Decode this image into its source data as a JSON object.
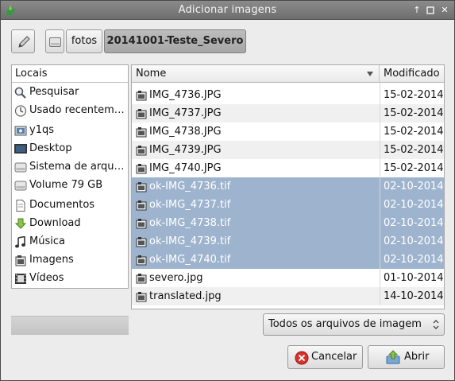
{
  "window": {
    "title": "Adicionar imagens"
  },
  "pathbar": {
    "segments": [
      "fotos",
      "20141001-Teste_Severo"
    ]
  },
  "places": {
    "header": "Locais",
    "items": [
      {
        "label": "Pesquisar",
        "icon": "search-icon"
      },
      {
        "label": "Usado recentem…",
        "icon": "clock-icon"
      },
      {
        "label": "y1qs",
        "icon": "home-folder-icon"
      },
      {
        "label": "Desktop",
        "icon": "desktop-icon"
      },
      {
        "label": "Sistema de arqu…",
        "icon": "harddisk-icon"
      },
      {
        "label": "Volume 79 GB",
        "icon": "harddisk-icon"
      },
      {
        "label": "Documentos",
        "icon": "document-icon"
      },
      {
        "label": "Download",
        "icon": "download-icon"
      },
      {
        "label": "Música",
        "icon": "music-icon"
      },
      {
        "label": "Imagens",
        "icon": "image-icon"
      },
      {
        "label": "Vídeos",
        "icon": "video-icon"
      }
    ]
  },
  "files": {
    "columns": {
      "name": "Nome",
      "modified": "Modificado"
    },
    "rows": [
      {
        "name": "IMG_4736.JPG",
        "date": "15-02-2014",
        "selected": false
      },
      {
        "name": "IMG_4737.JPG",
        "date": "15-02-2014",
        "selected": false
      },
      {
        "name": "IMG_4738.JPG",
        "date": "15-02-2014",
        "selected": false
      },
      {
        "name": "IMG_4739.JPG",
        "date": "15-02-2014",
        "selected": false
      },
      {
        "name": "IMG_4740.JPG",
        "date": "15-02-2014",
        "selected": false
      },
      {
        "name": "ok-IMG_4736.tif",
        "date": "02-10-2014",
        "selected": true
      },
      {
        "name": "ok-IMG_4737.tif",
        "date": "02-10-2014",
        "selected": true
      },
      {
        "name": "ok-IMG_4738.tif",
        "date": "02-10-2014",
        "selected": true
      },
      {
        "name": "ok-IMG_4739.tif",
        "date": "02-10-2014",
        "selected": true
      },
      {
        "name": "ok-IMG_4740.tif",
        "date": "02-10-2014",
        "selected": true
      },
      {
        "name": "severo.jpg",
        "date": "01-10-2014",
        "selected": false
      },
      {
        "name": "translated.jpg",
        "date": "14-10-2014",
        "selected": false
      }
    ]
  },
  "filter": {
    "selected": "Todos os arquivos de imagem"
  },
  "buttons": {
    "cancel": "Cancelar",
    "open": "Abrir"
  },
  "colors": {
    "selection": "#9eb4ce",
    "titlebar": "#7d7d7d",
    "cancel_icon": "#d9302a"
  }
}
